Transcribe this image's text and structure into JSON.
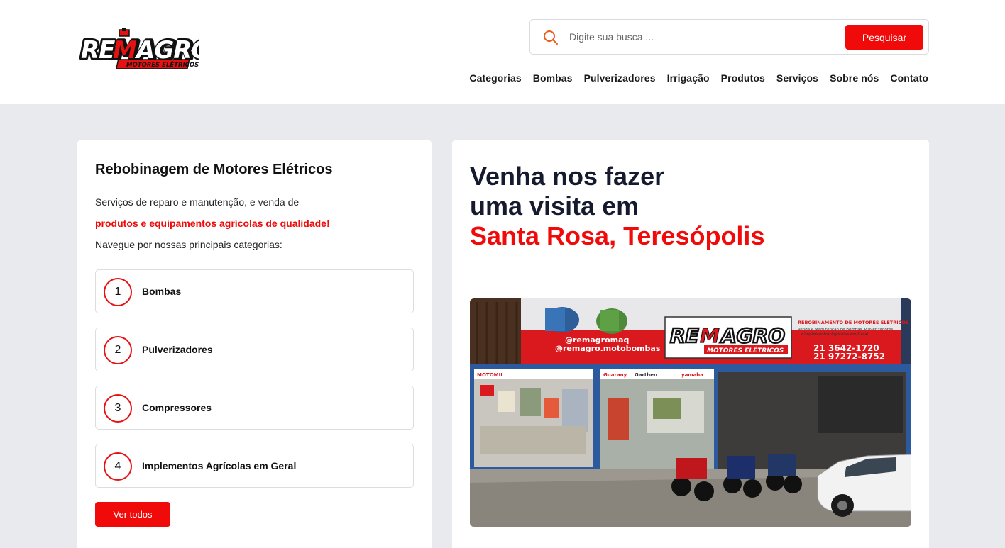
{
  "logo": {
    "brand": "REMAGRO",
    "tagline": "MOTORES ELÉTRICOS"
  },
  "search": {
    "placeholder": "Digite sua busca ...",
    "button_label": "Pesquisar"
  },
  "nav": {
    "items": [
      "Categorias",
      "Bombas",
      "Pulverizadores",
      "Irrigação",
      "Produtos",
      "Serviços",
      "Sobre nós",
      "Contato"
    ]
  },
  "services": {
    "title": "Rebobinagem de Motores Elétricos",
    "intro": "Serviços de reparo e manutenção, e venda de",
    "highlight": "produtos e equipamentos agrícolas de qualidade!",
    "browse": "Navegue por nossas principais categorias:",
    "categories": [
      {
        "number": "1",
        "label": "Bombas"
      },
      {
        "number": "2",
        "label": "Pulverizadores"
      },
      {
        "number": "3",
        "label": "Compressores"
      },
      {
        "number": "4",
        "label": "Implementos Agrícolas em Geral"
      }
    ],
    "see_all_label": "Ver todos"
  },
  "visit": {
    "line1": "Venha nos fazer",
    "line2": "uma visita em",
    "place": "Santa Rosa, Teresópolis"
  },
  "storefront": {
    "social_facebook": "@remagromaq",
    "social_instagram": "@remagro.motobombas",
    "sign_text": "REBOBINAMENTO DE MOTORES ELÉTRICOS",
    "sign_subtext_1": "Venda e Manutenção de Bombas, Pulverizadores",
    "sign_subtext_2": "e Implementos Agrícolas em Geral",
    "phone_1": "21  3642-1720",
    "phone_2": "21  97272-8752",
    "brand_1": "MOTOMIL",
    "brand_2": "Guarany",
    "brand_3": "Garthen",
    "brand_4": "yamaha"
  },
  "colors": {
    "accent": "#f00a0a",
    "heading": "#151a2e",
    "background": "#e9eaee"
  }
}
